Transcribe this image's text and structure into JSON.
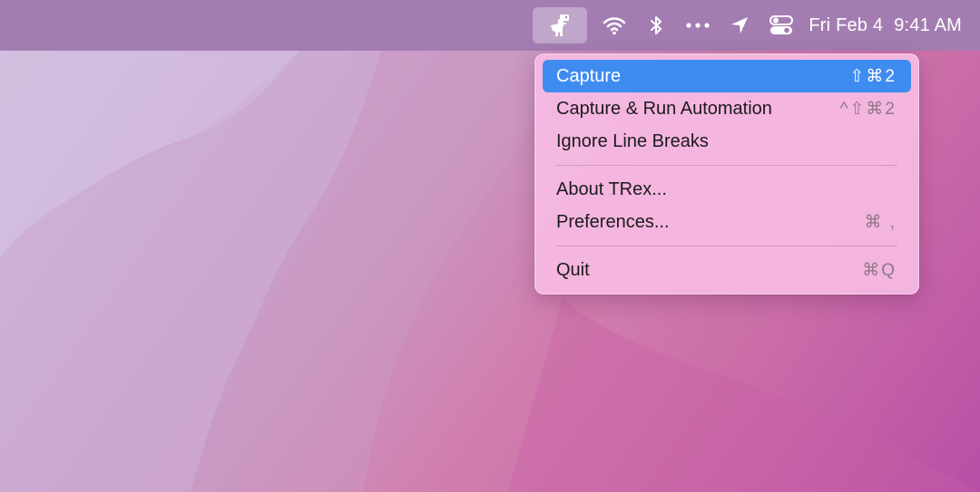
{
  "menubar": {
    "app_icon": "trex-dinosaur-icon",
    "status_icons": [
      "wifi-icon",
      "bluetooth-icon",
      "more-icon",
      "location-icon",
      "control-center-icon"
    ],
    "date": "Fri Feb 4",
    "time": "9:41 AM"
  },
  "menu": {
    "items": [
      {
        "label": "Capture",
        "shortcut": "⇧⌘2",
        "highlighted": true
      },
      {
        "label": "Capture & Run Automation",
        "shortcut": "^⇧⌘2"
      },
      {
        "label": "Ignore Line Breaks",
        "shortcut": ""
      },
      {
        "label": "About TRex...",
        "shortcut": ""
      },
      {
        "label": "Preferences...",
        "shortcut": "⌘ ,"
      },
      {
        "label": "Quit",
        "shortcut": "⌘Q"
      }
    ]
  },
  "colors": {
    "highlight": "#3f8cf1",
    "menubar": "#a37db1",
    "menu_bg": "#f6bae2"
  }
}
